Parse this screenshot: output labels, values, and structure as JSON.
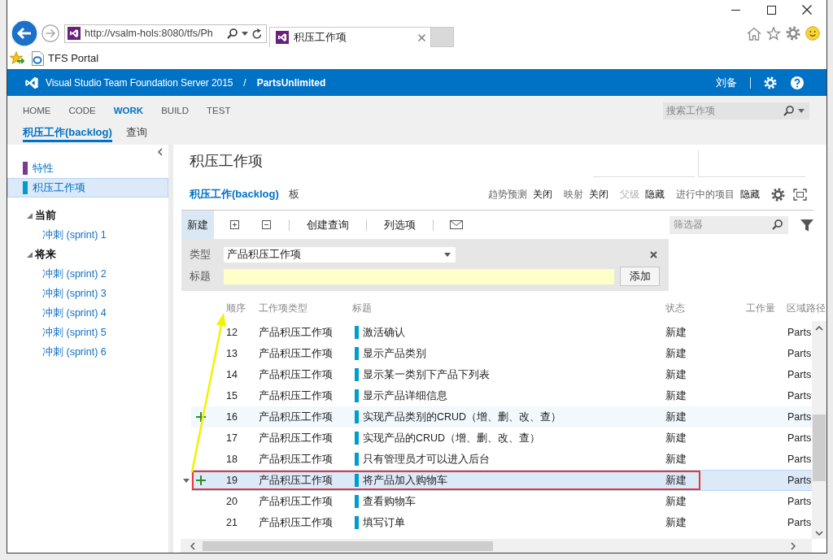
{
  "browser": {
    "address": "http://vsalm-hols:8080/tfs/Ph",
    "tab": {
      "title": "积压工作项"
    },
    "favorites": [
      {
        "label": "TFS Portal"
      }
    ]
  },
  "header": {
    "product": "Visual Studio Team Foundation Server 2015",
    "separator": "/",
    "project": "PartsUnlimited",
    "user": "刘备"
  },
  "hubs": [
    {
      "label": "HOME",
      "selected": false
    },
    {
      "label": "CODE",
      "selected": false
    },
    {
      "label": "WORK",
      "selected": true
    },
    {
      "label": "BUILD",
      "selected": false
    },
    {
      "label": "TEST",
      "selected": false
    }
  ],
  "hub_search": {
    "placeholder": "搜索工作项"
  },
  "subhubs": [
    {
      "label": "积压工作(backlog)",
      "selected": true
    },
    {
      "label": "查询",
      "selected": false
    }
  ],
  "sidebar": {
    "items": [
      {
        "label": "特性",
        "color": "#773b93",
        "selected": false
      },
      {
        "label": "积压工作项",
        "color": "#009ccc",
        "selected": true
      }
    ],
    "groups": [
      {
        "label": "当前",
        "expanded": true,
        "children": [
          {
            "label": "冲刺 (sprint) 1"
          }
        ]
      },
      {
        "label": "将来",
        "expanded": true,
        "children": [
          {
            "label": "冲刺 (sprint) 2"
          },
          {
            "label": "冲刺 (sprint) 3"
          },
          {
            "label": "冲刺 (sprint) 4"
          },
          {
            "label": "冲刺 (sprint) 5"
          },
          {
            "label": "冲刺 (sprint) 6"
          }
        ]
      }
    ]
  },
  "page": {
    "title": "积压工作项",
    "views": [
      {
        "label": "积压工作(backlog)",
        "selected": true
      },
      {
        "label": "板",
        "selected": false
      }
    ],
    "settings": [
      {
        "label": "趋势预测",
        "value": "关闭",
        "disabled": false
      },
      {
        "label": "映射",
        "value": "关闭",
        "disabled": false
      },
      {
        "label": "父级",
        "value": "隐藏",
        "disabled": true
      },
      {
        "label": "进行中的项目",
        "value": "隐藏",
        "disabled": false
      }
    ]
  },
  "toolbar": {
    "groups": [
      {
        "items": [
          {
            "kind": "button",
            "label": "新建",
            "selected": true
          },
          {
            "kind": "expand-all",
            "selected": false
          },
          {
            "kind": "collapse-all",
            "selected": false
          }
        ]
      },
      {
        "items": [
          {
            "kind": "button",
            "label": "创建查询",
            "selected": false
          }
        ]
      },
      {
        "items": [
          {
            "kind": "button",
            "label": "列选项",
            "selected": false
          }
        ]
      },
      {
        "items": [
          {
            "kind": "email",
            "selected": false
          }
        ]
      }
    ],
    "filter": {
      "placeholder": "筛选器"
    }
  },
  "add_panel": {
    "type_label": "类型",
    "type_value": "产品积压工作项",
    "title_label": "标题",
    "button": "添加"
  },
  "table": {
    "columns": [
      "顺序",
      "工作项类型",
      "标题",
      "状态",
      "工作量",
      "区域路径"
    ],
    "pointer_arrow": true,
    "rows": [
      {
        "order": "12",
        "type": "产品积压工作项",
        "title": "激活确认",
        "state": "新建",
        "area_path": "Parts",
        "selected": false,
        "hovered": false,
        "outlined": false
      },
      {
        "order": "13",
        "type": "产品积压工作项",
        "title": "显示产品类别",
        "state": "新建",
        "area_path": "Parts",
        "selected": false,
        "hovered": false,
        "outlined": false
      },
      {
        "order": "14",
        "type": "产品积压工作项",
        "title": "显示某一类别下产品下列表",
        "state": "新建",
        "area_path": "Parts",
        "selected": false,
        "hovered": false,
        "outlined": false
      },
      {
        "order": "15",
        "type": "产品积压工作项",
        "title": "显示产品详细信息",
        "state": "新建",
        "area_path": "Parts",
        "selected": false,
        "hovered": false,
        "outlined": false
      },
      {
        "order": "16",
        "type": "产品积压工作项",
        "title": "实现产品类别的CRUD（增、删、改、查）",
        "state": "新建",
        "area_path": "Parts",
        "selected": false,
        "hovered": true,
        "outlined": false
      },
      {
        "order": "17",
        "type": "产品积压工作项",
        "title": "实现产品的CRUD（增、删、改、查）",
        "state": "新建",
        "area_path": "Parts",
        "selected": false,
        "hovered": false,
        "outlined": false
      },
      {
        "order": "18",
        "type": "产品积压工作项",
        "title": "只有管理员才可以进入后台",
        "state": "新建",
        "area_path": "Parts",
        "selected": false,
        "hovered": false,
        "outlined": false
      },
      {
        "order": "19",
        "type": "产品积压工作项",
        "title": "将产品加入购物车",
        "state": "新建",
        "area_path": "Parts",
        "selected": true,
        "hovered": false,
        "outlined": true
      },
      {
        "order": "20",
        "type": "产品积压工作项",
        "title": "查看购物车",
        "state": "新建",
        "area_path": "Parts",
        "selected": false,
        "hovered": false,
        "outlined": false
      },
      {
        "order": "21",
        "type": "产品积压工作项",
        "title": "填写订单",
        "state": "新建",
        "area_path": "Parts",
        "selected": false,
        "hovered": false,
        "outlined": false
      }
    ]
  }
}
